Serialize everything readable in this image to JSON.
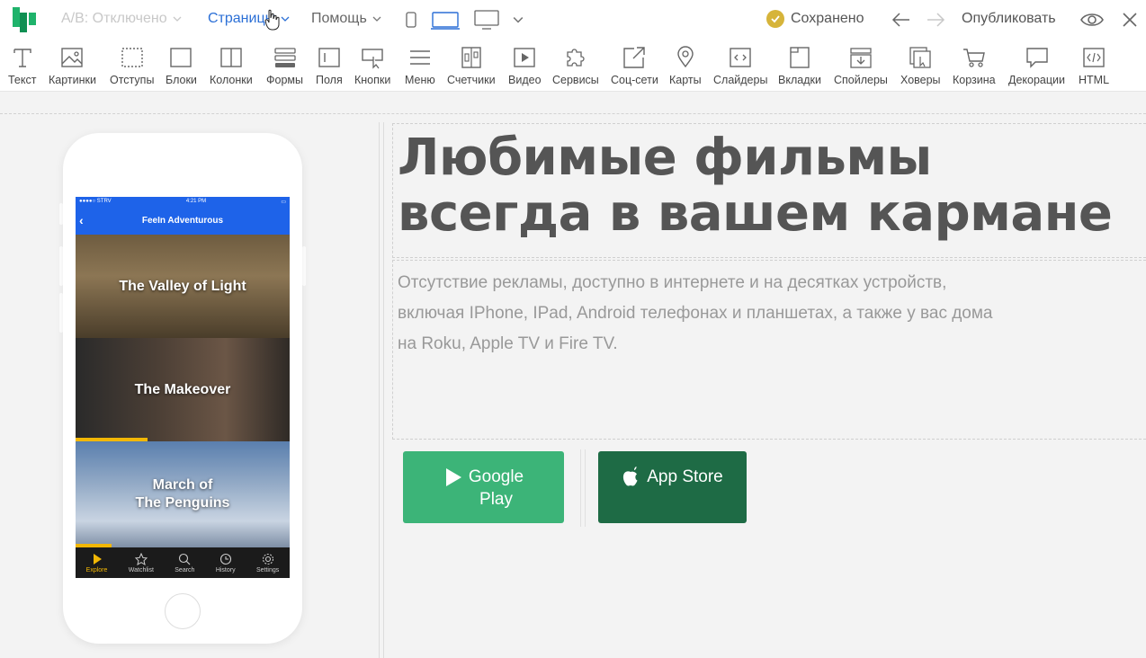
{
  "topbar": {
    "ab_label": "A/B: Отключено",
    "pages_label": "Страницы",
    "help_label": "Помощь",
    "saved_label": "Сохранено",
    "publish_label": "Опубликовать"
  },
  "toolbar": {
    "items": [
      {
        "label": "Текст",
        "icon": "text-icon"
      },
      {
        "label": "Картинки",
        "icon": "image-icon"
      },
      {
        "label": "Отступы",
        "icon": "padding-icon"
      },
      {
        "label": "Блоки",
        "icon": "block-icon"
      },
      {
        "label": "Колонки",
        "icon": "columns-icon"
      },
      {
        "label": "Формы",
        "icon": "forms-icon"
      },
      {
        "label": "Поля",
        "icon": "fields-icon"
      },
      {
        "label": "Кнопки",
        "icon": "buttons-icon"
      },
      {
        "label": "Меню",
        "icon": "menu-icon"
      },
      {
        "label": "Счетчики",
        "icon": "counter-icon"
      },
      {
        "label": "Видео",
        "icon": "video-icon"
      },
      {
        "label": "Сервисы",
        "icon": "puzzle-icon"
      },
      {
        "label": "Соц-сети",
        "icon": "share-icon"
      },
      {
        "label": "Карты",
        "icon": "map-pin-icon"
      },
      {
        "label": "Слайдеры",
        "icon": "slider-icon"
      },
      {
        "label": "Вкладки",
        "icon": "tabs-icon"
      },
      {
        "label": "Спойлеры",
        "icon": "spoiler-icon"
      },
      {
        "label": "Ховеры",
        "icon": "hover-icon"
      },
      {
        "label": "Корзина",
        "icon": "cart-icon"
      },
      {
        "label": "Декорации",
        "icon": "decoration-icon"
      },
      {
        "label": "HTML",
        "icon": "code-icon"
      }
    ]
  },
  "phone": {
    "carrier": "●●●●○ STRV",
    "time": "4:21 PM",
    "nav_title": "FeeIn Adventurous",
    "movies": [
      "The Valley of Light",
      "The Makeover",
      "March of The Penguins"
    ],
    "movie3_line1": "March of",
    "movie3_line2": "The Penguins",
    "tabs": [
      "Explore",
      "Watchlist",
      "Search",
      "History",
      "Settings"
    ]
  },
  "content": {
    "headline": "Любимые фильмы всегда в вашем кармане",
    "paragraph": "Отсутствие рекламы, доступно в интернете и на десятках устройств, включая IPhone, IPad, Android телефонах и планшетах, а также у вас дома на Roku, Apple TV и Fire TV.",
    "google_play_line1": "Google",
    "google_play_line2": "Play",
    "app_store_label": "App Store"
  },
  "colors": {
    "accent_blue": "#2b6fd6",
    "brand_green": "#1fb36b",
    "google_play_btn": "#3cb478",
    "app_store_btn": "#1e6b45",
    "saved_badge": "#d6b43a"
  }
}
